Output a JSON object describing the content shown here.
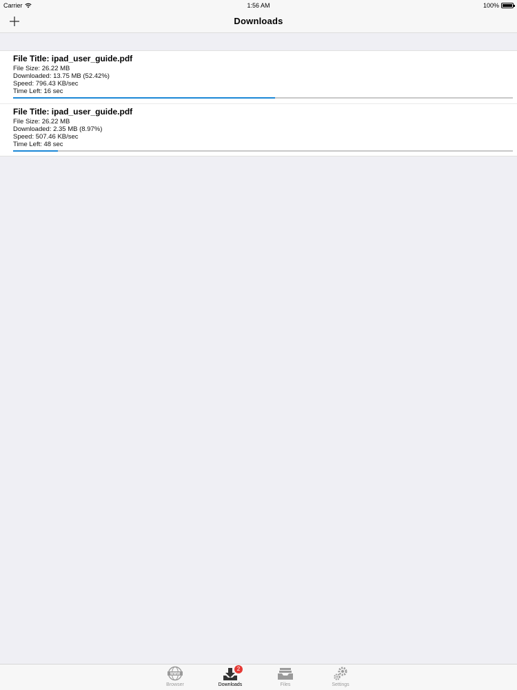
{
  "status_bar": {
    "carrier": "Carrier",
    "time": "1:56 AM",
    "battery": "100%"
  },
  "nav": {
    "title": "Downloads"
  },
  "downloads": [
    {
      "title": "File Title: ipad_user_guide.pdf",
      "size": "File Size: 26.22 MB",
      "downloaded": "Downloaded: 13.75 MB (52.42%)",
      "speed": "Speed: 796.43 KB/sec",
      "time_left": "Time Left: 16 sec",
      "progress": 0.5242
    },
    {
      "title": "File Title: ipad_user_guide.pdf",
      "size": "File Size: 26.22 MB",
      "downloaded": "Downloaded: 2.35 MB (8.97%)",
      "speed": "Speed: 507.46 KB/sec",
      "time_left": "Time Left: 48 sec",
      "progress": 0.0897
    }
  ],
  "tabs": [
    {
      "label": "Browser",
      "icon": "globe-www-icon"
    },
    {
      "label": "Downloads",
      "icon": "download-tray-icon",
      "badge": "2",
      "active": true
    },
    {
      "label": "Files",
      "icon": "file-tray-icon"
    },
    {
      "label": "Settings",
      "icon": "gears-icon"
    }
  ],
  "colors": {
    "accent": "#1a87d6",
    "badge": "#e53935",
    "background": "#efeff4"
  }
}
